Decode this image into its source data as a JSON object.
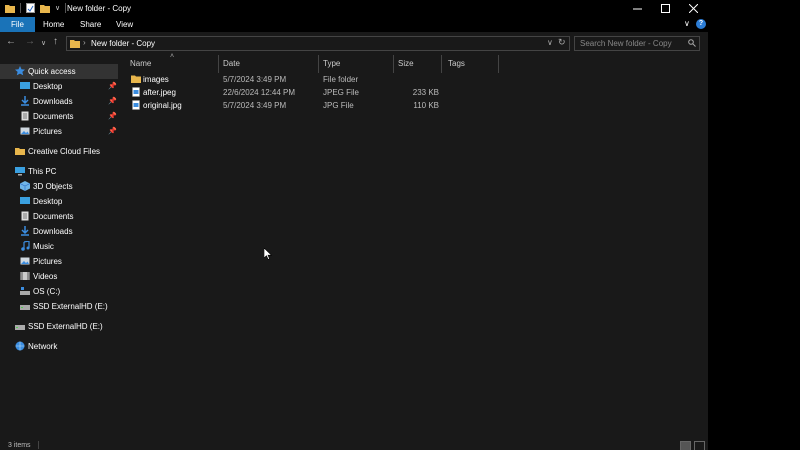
{
  "window": {
    "title": "New folder - Copy"
  },
  "ribbon": {
    "tabs": [
      "File",
      "Home",
      "Share",
      "View"
    ]
  },
  "address": {
    "path": "New folder - Copy",
    "search_placeholder": "Search New folder - Copy"
  },
  "sidebar": {
    "items": [
      {
        "label": "Quick access",
        "icon": "star-icon",
        "pinned": false
      },
      {
        "label": "Desktop",
        "icon": "desktop-icon",
        "pinned": true
      },
      {
        "label": "Downloads",
        "icon": "download-icon",
        "pinned": true
      },
      {
        "label": "Documents",
        "icon": "documents-icon",
        "pinned": true
      },
      {
        "label": "Pictures",
        "icon": "pictures-icon",
        "pinned": true
      },
      {
        "label": "Creative Cloud Files",
        "icon": "folder-icon",
        "pinned": false
      },
      {
        "label": "This PC",
        "icon": "computer-icon",
        "pinned": false
      },
      {
        "label": "3D Objects",
        "icon": "cube-icon",
        "pinned": false
      },
      {
        "label": "Desktop",
        "icon": "desktop-icon",
        "pinned": false
      },
      {
        "label": "Documents",
        "icon": "documents-icon",
        "pinned": false
      },
      {
        "label": "Downloads",
        "icon": "download-icon",
        "pinned": false
      },
      {
        "label": "Music",
        "icon": "music-icon",
        "pinned": false
      },
      {
        "label": "Pictures",
        "icon": "pictures-icon",
        "pinned": false
      },
      {
        "label": "Videos",
        "icon": "videos-icon",
        "pinned": false
      },
      {
        "label": "OS (C:)",
        "icon": "drive-icon",
        "pinned": false
      },
      {
        "label": "SSD ExternalHD (E:)",
        "icon": "drive-icon",
        "pinned": false
      },
      {
        "label": "SSD ExternalHD (E:)",
        "icon": "drive-icon",
        "pinned": false
      },
      {
        "label": "Network",
        "icon": "network-icon",
        "pinned": false
      }
    ]
  },
  "columns": [
    "Name",
    "Date",
    "Type",
    "Size",
    "Tags"
  ],
  "files": [
    {
      "name": "images",
      "date": "5/7/2024 3:49 PM",
      "type": "File folder",
      "size": "",
      "icon": "folder-icon"
    },
    {
      "name": "after.jpeg",
      "date": "22/6/2024 12:44 PM",
      "type": "JPEG File",
      "size": "233 KB",
      "icon": "image-file-icon"
    },
    {
      "name": "original.jpg",
      "date": "5/7/2024 3:49 PM",
      "type": "JPG File",
      "size": "110 KB",
      "icon": "image-file-icon"
    }
  ],
  "status": {
    "text": "3 items"
  },
  "colors": {
    "accent": "#1a73b8",
    "background": "#191919",
    "folder": "#e8b64c"
  }
}
